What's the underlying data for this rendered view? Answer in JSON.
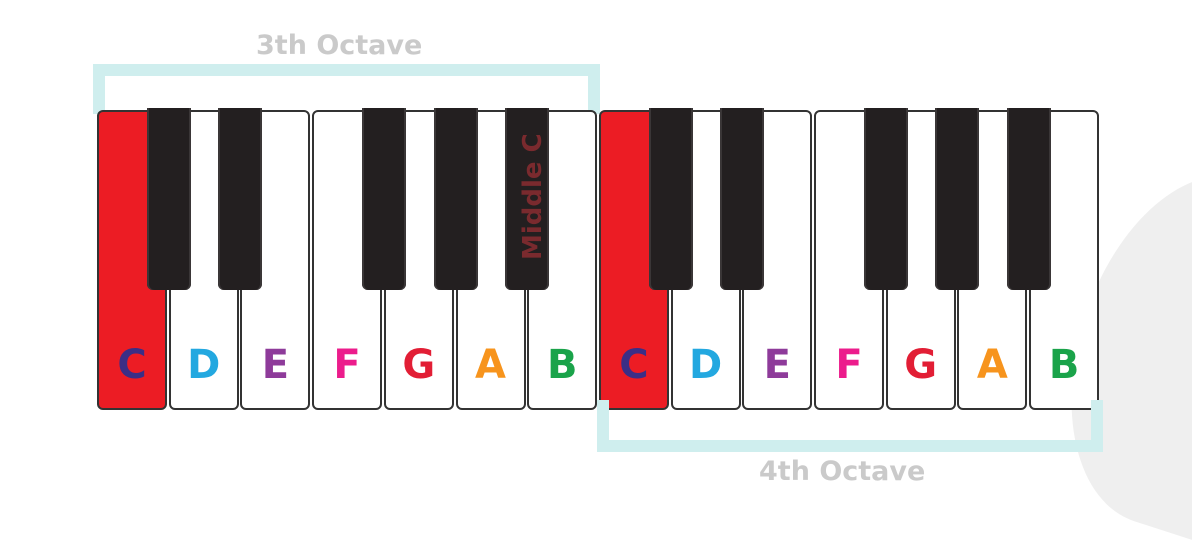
{
  "octaves": {
    "top_label": "3th Octave",
    "bottom_label": "4th Octave"
  },
  "middle_c_label": "Middle C",
  "white_keys": [
    {
      "note": "C",
      "color": "#3b2e86",
      "highlight": true
    },
    {
      "note": "D",
      "color": "#23a8e0",
      "highlight": false
    },
    {
      "note": "E",
      "color": "#8e3b9a",
      "highlight": false
    },
    {
      "note": "F",
      "color": "#ec1c8c",
      "highlight": false
    },
    {
      "note": "G",
      "color": "#e21e35",
      "highlight": false
    },
    {
      "note": "A",
      "color": "#f7941d",
      "highlight": false
    },
    {
      "note": "B",
      "color": "#1aa34a",
      "highlight": false
    },
    {
      "note": "C",
      "color": "#3b2e86",
      "highlight": true
    },
    {
      "note": "D",
      "color": "#23a8e0",
      "highlight": false
    },
    {
      "note": "E",
      "color": "#8e3b9a",
      "highlight": false
    },
    {
      "note": "F",
      "color": "#ec1c8c",
      "highlight": false
    },
    {
      "note": "G",
      "color": "#e21e35",
      "highlight": false
    },
    {
      "note": "A",
      "color": "#f7941d",
      "highlight": false
    },
    {
      "note": "B",
      "color": "#1aa34a",
      "highlight": false
    }
  ],
  "colors": {
    "highlight_key": "#ec1c24",
    "black_key": "#231f20",
    "bracket": "#cfeeee",
    "octave_label": "#cacaca"
  }
}
